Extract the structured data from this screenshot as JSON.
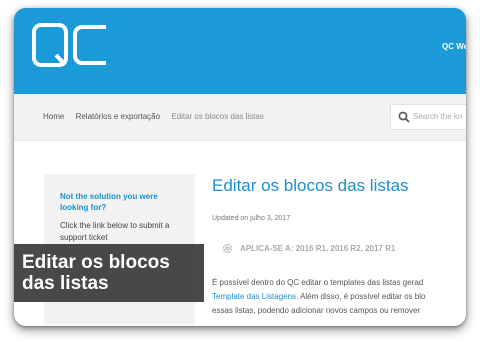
{
  "header": {
    "logo_text": "QC",
    "nav_link": "QC We"
  },
  "breadcrumb": {
    "items": [
      "Home",
      "Relatórios e exportação",
      "Editar os blocos das listas"
    ]
  },
  "search": {
    "placeholder": "Search the kn"
  },
  "sidebar": {
    "title": "Not the solution you were looking for?",
    "text": "Click the link below to submit a support ticket"
  },
  "article": {
    "title": "Editar os blocos das listas",
    "updated": "Updated on julho 3, 2017",
    "applies": "APLICA-SE A: 2016 R1, 2016 R2, 2017 R1",
    "body": {
      "line1": "É possível dentro do QC editar o templates das listas gerad",
      "line2_link": "Template das Listagens",
      "line2_rest": ". Além disso, é possível editar os blo",
      "line3": "essas listas, podendo adicionar novos campos ou remover"
    }
  },
  "overlay": {
    "title": "Editar os blocos das listas"
  },
  "colors": {
    "header_bg": "#1a9ad6",
    "accent": "#1a8fcf",
    "subnav_bg": "#f2f2f2",
    "overlay_bg": "#303030"
  }
}
